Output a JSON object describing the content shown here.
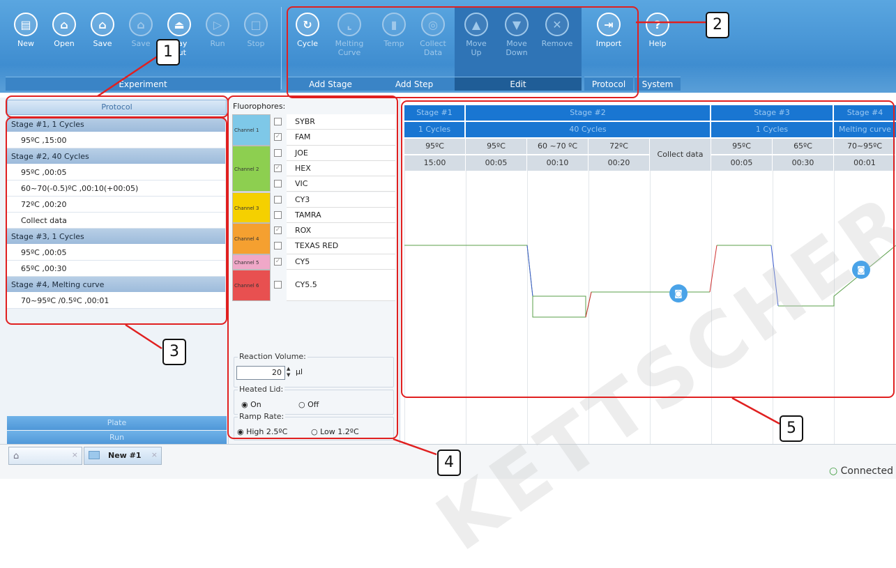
{
  "ribbon": {
    "experiment": {
      "label": "Experiment",
      "buttons": [
        {
          "label": "New",
          "icon": "document-icon",
          "enabled": true
        },
        {
          "label": "Open",
          "icon": "folder-open-icon",
          "enabled": true
        },
        {
          "label": "Save",
          "icon": "save-icon",
          "enabled": true
        },
        {
          "label": "Save",
          "icon": "save-as-icon",
          "enabled": false
        },
        {
          "label": "Tray\nOut",
          "icon": "eject-icon",
          "enabled": true
        },
        {
          "label": "Run",
          "icon": "play-icon",
          "enabled": false
        },
        {
          "label": "Stop",
          "icon": "stop-icon",
          "enabled": false
        }
      ]
    },
    "add_stage": {
      "label": "Add Stage",
      "buttons": [
        {
          "label": "Cycle",
          "icon": "cycle-icon",
          "enabled": true
        },
        {
          "label": "Melting\nCurve",
          "icon": "melting-curve-icon",
          "enabled": false
        }
      ]
    },
    "add_step": {
      "label": "Add Step",
      "buttons": [
        {
          "label": "Temp",
          "icon": "thermometer-icon",
          "enabled": false
        },
        {
          "label": "Collect\nData",
          "icon": "collect-data-icon",
          "enabled": false
        }
      ]
    },
    "edit": {
      "label": "Edit",
      "buttons": [
        {
          "label": "Move\nUp",
          "icon": "arrow-up-icon",
          "enabled": false
        },
        {
          "label": "Move\nDown",
          "icon": "arrow-down-icon",
          "enabled": false
        },
        {
          "label": "Remove",
          "icon": "remove-icon",
          "enabled": false
        }
      ]
    },
    "protocol": {
      "label": "Protocol",
      "buttons": [
        {
          "label": "Import",
          "icon": "import-icon",
          "enabled": true
        }
      ]
    },
    "system": {
      "label": "System",
      "buttons": [
        {
          "label": "Help",
          "icon": "help-icon",
          "enabled": true
        }
      ]
    }
  },
  "left_panel": {
    "header": "Protocol",
    "stages": [
      {
        "title": "Stage #1, 1 Cycles",
        "steps": [
          "95ºC ,15:00"
        ]
      },
      {
        "title": "Stage #2, 40 Cycles",
        "steps": [
          "95ºC ,00:05",
          "60~70(-0.5)ºC ,00:10(+00:05)",
          "72ºC ,00:20",
          "Collect data"
        ]
      },
      {
        "title": "Stage #3, 1 Cycles",
        "steps": [
          "95ºC ,00:05",
          "65ºC ,00:30"
        ]
      },
      {
        "title": "Stage #4, Melting curve",
        "steps": [
          "70~95ºC /0.5ºC ,00:01"
        ]
      }
    ],
    "bottom_buttons": [
      "Plate",
      "Run"
    ]
  },
  "fluorophores": {
    "title": "Fluorophores:",
    "channels": [
      {
        "name": "Channel 1",
        "color": "#7ec8e8"
      },
      {
        "name": "Channel 2",
        "color": "#8dcf50"
      },
      {
        "name": "Channel 3",
        "color": "#f5d000"
      },
      {
        "name": "Channel 4",
        "color": "#f5a030"
      },
      {
        "name": "Channel 5",
        "color": "#f0a8c8"
      },
      {
        "name": "Channel 6",
        "color": "#e85050"
      }
    ],
    "dyes": [
      {
        "name": "SYBR",
        "checked": false
      },
      {
        "name": "FAM",
        "checked": true
      },
      {
        "name": "JOE",
        "checked": false
      },
      {
        "name": "HEX",
        "checked": true
      },
      {
        "name": "VIC",
        "checked": false
      },
      {
        "name": "CY3",
        "checked": false
      },
      {
        "name": "TAMRA",
        "checked": false
      },
      {
        "name": "ROX",
        "checked": true
      },
      {
        "name": "TEXAS RED",
        "checked": false
      },
      {
        "name": "CY5",
        "checked": true
      },
      {
        "name": "CY5.5",
        "checked": false
      }
    ],
    "reaction_volume": {
      "label": "Reaction Volume:",
      "value": "20",
      "unit": "µl"
    },
    "heated_lid": {
      "label": "Heated Lid:",
      "on": "On",
      "off": "Off",
      "selected": "On"
    },
    "ramp_rate": {
      "label": "Ramp Rate:",
      "high": "High 2.5ºC",
      "low": "Low 1.2ºC",
      "selected": "High"
    }
  },
  "graph": {
    "stages": [
      "Stage #1",
      "Stage #2",
      "Stage #3",
      "Stage #4"
    ],
    "cycles": [
      "1 Cycles",
      "40 Cycles",
      "1 Cycles",
      "Melting curve"
    ],
    "temps": [
      "95ºC",
      "95ºC",
      "60 ~70 ºC",
      "72ºC",
      "95ºC",
      "65ºC",
      "70~95ºC"
    ],
    "times": [
      "15:00",
      "00:05",
      "00:10",
      "00:20",
      "00:05",
      "00:30",
      "00:01"
    ],
    "collect": "Collect data"
  },
  "tabs": [
    {
      "label": ""
    },
    {
      "label": "New #1"
    }
  ],
  "status": "Connected",
  "annotations": [
    "1",
    "2",
    "3",
    "4",
    "5"
  ],
  "watermark": "KETTSCHER SAS"
}
